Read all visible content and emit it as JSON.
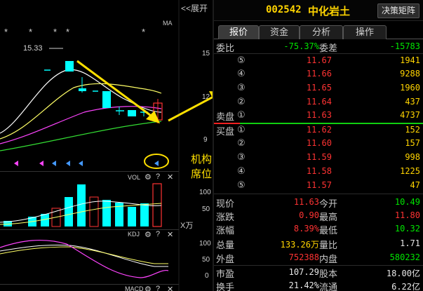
{
  "chart": {
    "expand_label": "<<展开",
    "ma_label": "MA",
    "stars": [
      "*",
      "*",
      "*",
      "*",
      "*",
      "*"
    ],
    "price_high_label": "15.33",
    "axis": {
      "p15": "15",
      "p12": "12",
      "p9": "9"
    },
    "annotation": "机构席位",
    "vol": {
      "label": "VOL",
      "axis_100": "100",
      "axis_50": "50",
      "unit": "X万"
    },
    "kdj": {
      "label": "KDJ",
      "axis_100": "100",
      "axis_50": "50",
      "axis_0": "0"
    },
    "macd": {
      "label": "MACD"
    },
    "icons": {
      "settings": "⚙",
      "help": "?",
      "close": "✕"
    },
    "colors": {
      "up": "#ff3333",
      "down": "#00ffff",
      "ma5": "#ffffff",
      "ma10": "#ffff66",
      "ma20": "#ff44ff",
      "ma60": "#33dd33",
      "annotation": "#ffe000"
    }
  },
  "quote": {
    "code": "002542",
    "name": "中化岩土",
    "decision_button": "决策矩阵",
    "tabs": [
      {
        "label": "报价",
        "active": true
      },
      {
        "label": "资金",
        "active": false
      },
      {
        "label": "分析",
        "active": false
      },
      {
        "label": "操作",
        "active": false
      }
    ],
    "weibi_label": "委比",
    "weibi_value": "-75.37%",
    "weicha_label": "委差",
    "weicha_value": "-15783",
    "asks": [
      {
        "level": "⑤",
        "price": "11.67",
        "volume": "1941"
      },
      {
        "level": "④",
        "price": "11.66",
        "volume": "9288"
      },
      {
        "level": "③",
        "price": "11.65",
        "volume": "1960"
      },
      {
        "level": "②",
        "price": "11.64",
        "volume": "437"
      },
      {
        "level": "①",
        "price": "11.63",
        "volume": "4737"
      }
    ],
    "bids": [
      {
        "level": "①",
        "price": "11.62",
        "volume": "152"
      },
      {
        "level": "②",
        "price": "11.60",
        "volume": "157"
      },
      {
        "level": "③",
        "price": "11.59",
        "volume": "998"
      },
      {
        "level": "④",
        "price": "11.58",
        "volume": "1225"
      },
      {
        "level": "⑤",
        "price": "11.57",
        "volume": "47"
      }
    ],
    "sell_label": "卖盘",
    "buy_label": "买盘",
    "stats": [
      {
        "l1": "现价",
        "v1": "11.63",
        "c1": "red",
        "l2": "今开",
        "v2": "10.49",
        "c2": "green"
      },
      {
        "l1": "涨跌",
        "v1": "0.90",
        "c1": "red",
        "l2": "最高",
        "v2": "11.80",
        "c2": "red"
      },
      {
        "l1": "涨幅",
        "v1": "8.39%",
        "c1": "red",
        "l2": "最低",
        "v2": "10.32",
        "c2": "green"
      },
      {
        "l1": "总量",
        "v1": "133.26万",
        "c1": "yellow",
        "l2": "量比",
        "v2": "1.71",
        "c2": "white"
      },
      {
        "l1": "外盘",
        "v1": "752388",
        "c1": "red",
        "l2": "内盘",
        "v2": "580232",
        "c2": "green"
      },
      {
        "l1": "市盈",
        "v1": "107.29",
        "c1": "white",
        "l2": "股本",
        "v2": "18.00亿",
        "c2": "white"
      },
      {
        "l1": "换手",
        "v1": "21.42%",
        "c1": "white",
        "l2": "流通",
        "v2": "6.22亿",
        "c2": "white"
      }
    ]
  }
}
